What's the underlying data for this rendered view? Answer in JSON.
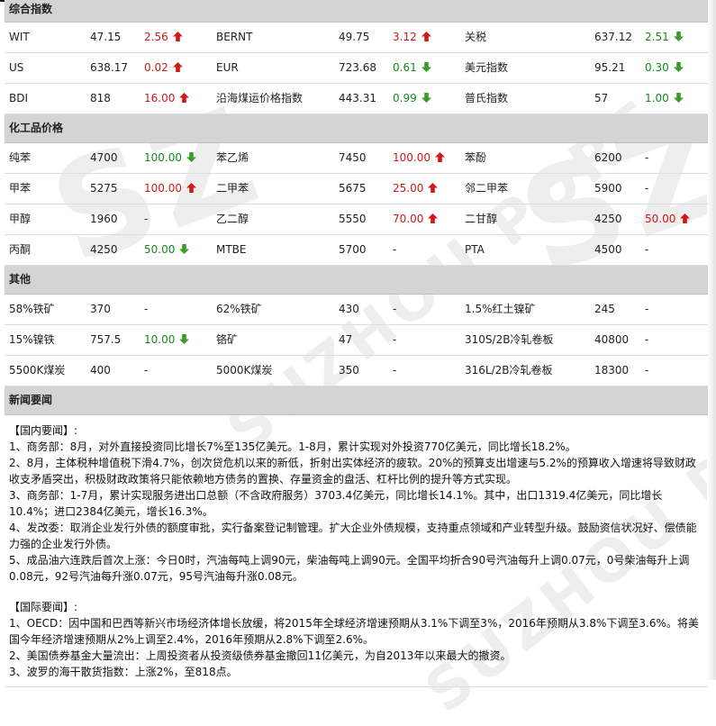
{
  "sections": {
    "composite": {
      "title": "综合指数",
      "rows": [
        [
          {
            "name": "WIT",
            "price": "47.15",
            "chg": "2.56",
            "dir": "up"
          },
          {
            "name": "BERNT",
            "price": "49.75",
            "chg": "3.12",
            "dir": "up"
          },
          {
            "name": "关税",
            "price": "637.12",
            "chg": "2.51",
            "dir": "down"
          }
        ],
        [
          {
            "name": "US",
            "price": "638.17",
            "chg": "0.02",
            "dir": "up"
          },
          {
            "name": "EUR",
            "price": "723.68",
            "chg": "0.61",
            "dir": "down"
          },
          {
            "name": "美元指数",
            "price": "95.21",
            "chg": "0.30",
            "dir": "down"
          }
        ],
        [
          {
            "name": "BDI",
            "price": "818",
            "chg": "16.00",
            "dir": "up"
          },
          {
            "name": "沿海煤运价格指数",
            "price": "443.31",
            "chg": "0.99",
            "dir": "down"
          },
          {
            "name": "普氏指数",
            "price": "57",
            "chg": "1.00",
            "dir": "down"
          }
        ]
      ]
    },
    "chemical": {
      "title": "化工品价格",
      "rows": [
        [
          {
            "name": "纯苯",
            "price": "4700",
            "chg": "100.00",
            "dir": "down"
          },
          {
            "name": "苯乙烯",
            "price": "7450",
            "chg": "100.00",
            "dir": "up"
          },
          {
            "name": "苯酚",
            "price": "6200",
            "chg": "-",
            "dir": "none"
          }
        ],
        [
          {
            "name": "甲苯",
            "price": "5275",
            "chg": "100.00",
            "dir": "up"
          },
          {
            "name": "二甲苯",
            "price": "5675",
            "chg": "25.00",
            "dir": "up"
          },
          {
            "name": "邻二甲苯",
            "price": "5900",
            "chg": "-",
            "dir": "none"
          }
        ],
        [
          {
            "name": "甲醇",
            "price": "1960",
            "chg": "-",
            "dir": "none"
          },
          {
            "name": "乙二醇",
            "price": "5550",
            "chg": "70.00",
            "dir": "up"
          },
          {
            "name": "二甘醇",
            "price": "4250",
            "chg": "50.00",
            "dir": "up"
          }
        ],
        [
          {
            "name": "丙酮",
            "price": "4250",
            "chg": "50.00",
            "dir": "down"
          },
          {
            "name": "MTBE",
            "price": "5700",
            "chg": "-",
            "dir": "none"
          },
          {
            "name": "PTA",
            "price": "4500",
            "chg": "-",
            "dir": "none"
          }
        ]
      ]
    },
    "other": {
      "title": "其他",
      "rows": [
        [
          {
            "name": "58%铁矿",
            "price": "370",
            "chg": "-",
            "dir": "none"
          },
          {
            "name": "62%铁矿",
            "price": "430",
            "chg": "-",
            "dir": "none"
          },
          {
            "name": "1.5%红土镍矿",
            "price": "245",
            "chg": "-",
            "dir": "none"
          }
        ],
        [
          {
            "name": "15%镍铁",
            "price": "757.5",
            "chg": "10.00",
            "dir": "down"
          },
          {
            "name": "铬矿",
            "price": "47",
            "chg": "-",
            "dir": "none"
          },
          {
            "name": "310S/2B冷轧卷板",
            "price": "40800",
            "chg": "-",
            "dir": "none"
          }
        ],
        [
          {
            "name": "5500K煤炭",
            "price": "400",
            "chg": "-",
            "dir": "none"
          },
          {
            "name": "5000K煤炭",
            "price": "350",
            "chg": "-",
            "dir": "none"
          },
          {
            "name": "316L/2B冷轧卷板",
            "price": "18300",
            "chg": "-",
            "dir": "none"
          }
        ]
      ]
    }
  },
  "news": {
    "title": "新闻要闻",
    "domestic_heading": "【国内要闻】:",
    "domestic": [
      "1、商务部：8月，对外直接投资同比增长7%至135亿美元。1-8月，累计实现对外投资770亿美元，同比增长18.2%。",
      "2、8月，主体税种增值税下滑4.7%，创次贷危机以来的新低，折射出实体经济的疲软。20%的预算支出增速与5.2%的预算收入增速将导致财政收支矛盾突出，积极财政政策将只能依赖地方债务的置换、存量资金的盘活、杠杆比例的提升等方式实现。",
      "3、商务部：1-7月，累计实现服务进出口总额（不含政府服务）3703.4亿美元，同比增长14.1%。其中，出口1319.4亿美元，同比增长10.4%；进口2384亿美元，增长16.3%。",
      "4、发改委：取消企业发行外债的额度审批，实行备案登记制管理。扩大企业外债规模，支持重点领域和产业转型升级。鼓励资信状况好、偿债能力强的企业发行外债。",
      "5、成品油六连跌后首次上涨：今日0时，汽油每吨上调90元，柴油每吨上调90元。全国平均折合90号汽油每升上调0.07元，0号柴油每升上调0.08元，92号汽油每升涨0.07元，95号汽油每升涨0.08元。"
    ],
    "intl_heading": "【国际要闻】:",
    "intl": [
      "1、OECD：因中国和巴西等新兴市场经济体增长放缓，将2015年全球经济增速预期从3.1%下调至3%，2016年预期从3.8%下调至3.6%。将美国今年经济增速预期从2%上调至2.4%，2016年预期从2.8%下调至2.6%。",
      "2、美国债券基金大量流出：上周投资者从投资级债券基金撤回11亿美元，为自2013年以来最大的撤资。",
      "3、波罗的海干散货指数：上涨2%，至818点。"
    ]
  },
  "watermark": {
    "text1": "SUZHOU PORT",
    "text2": "SZ"
  },
  "colors": {
    "up": "#d01818",
    "down": "#148a1c",
    "section_bg": "#d4d4d4"
  },
  "icons": {
    "up": "red-up-arrow-icon",
    "down": "green-down-arrow-icon"
  }
}
